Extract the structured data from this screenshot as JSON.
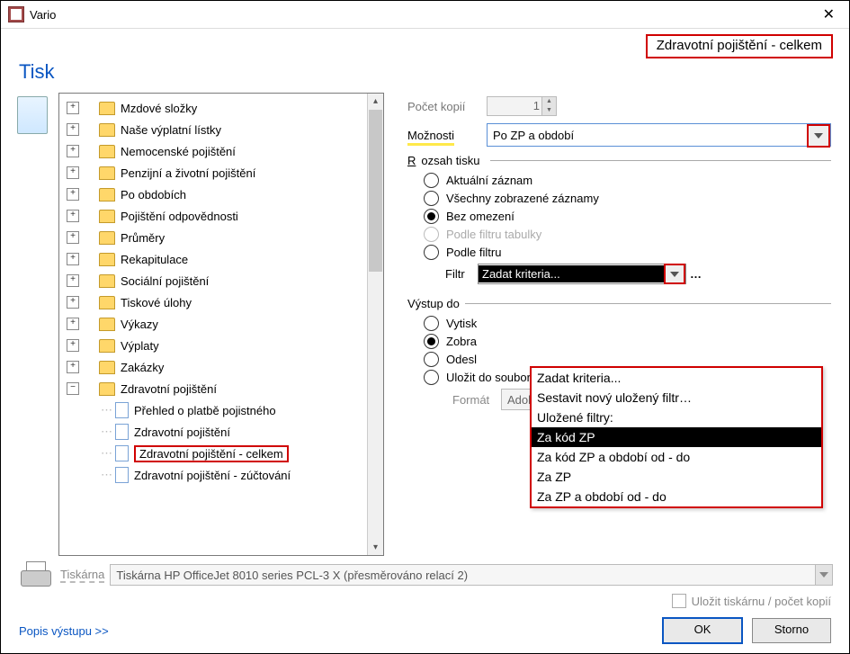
{
  "window": {
    "title": "Vario",
    "preview_name": "Zdravotní pojištění - celkem"
  },
  "heading": "Tisk",
  "tree": {
    "top_nodes": [
      "Mzdové složky",
      "Naše výplatní lístky",
      "Nemocenské pojištění",
      "Penzijní a životní pojištění",
      "Po obdobích",
      "Pojištění odpovědnosti",
      "Průměry",
      "Rekapitulace",
      "Sociální pojištění",
      "Tiskové úlohy",
      "Výkazy",
      "Výplaty",
      "Zakázky"
    ],
    "expanded_node": "Zdravotní pojištění",
    "children": [
      "Přehled o platbě pojistného",
      "Zdravotní pojištění",
      "Zdravotní pojištění - celkem",
      "Zdravotní pojištění - zúčtování"
    ],
    "selected_child_index": 2
  },
  "form": {
    "copies_label": "Počet kopií",
    "copies_value": "1",
    "options_label": "Možnosti",
    "options_value": "Po ZP a období"
  },
  "rozsah": {
    "title": "Rozsah tisku",
    "items": [
      {
        "label": "Aktuální záznam",
        "checked": false,
        "disabled": false
      },
      {
        "label": "Všechny zobrazené záznamy",
        "checked": false,
        "disabled": false
      },
      {
        "label": "Bez omezení",
        "checked": true,
        "disabled": false
      },
      {
        "label": "Podle filtru tabulky",
        "checked": false,
        "disabled": true
      },
      {
        "label": "Podle filtru",
        "checked": false,
        "disabled": false
      }
    ],
    "filtr_label": "Filtr",
    "filtr_value": "Zadat kriteria...",
    "filtr_more": "…"
  },
  "dropdown": {
    "items": [
      "Zadat kriteria...",
      "Sestavit nový uložený filtr…",
      "Uložené filtry:",
      "Za kód ZP",
      "Za kód ZP a období od - do",
      "Za ZP",
      "Za ZP a období od - do"
    ],
    "selected_index": 3
  },
  "vystup": {
    "title": "Výstup do",
    "items": [
      {
        "label": "Vytisk",
        "checked": false
      },
      {
        "label": "Zobra",
        "checked": true
      },
      {
        "label": "Odesl",
        "checked": false
      },
      {
        "label": "Uložit do souboru",
        "checked": false
      }
    ],
    "format_label": "Formát",
    "format_value": "Adobe Acrobat (pdf)"
  },
  "printer": {
    "label": "Tiskárna",
    "value": "Tiskárna HP OfficeJet 8010 series PCL-3 X (přesměrováno relací 2)",
    "save_label": "Uložit tiskárnu / počet kopií"
  },
  "footer": {
    "link": "Popis výstupu >>",
    "ok": "OK",
    "cancel": "Storno"
  }
}
